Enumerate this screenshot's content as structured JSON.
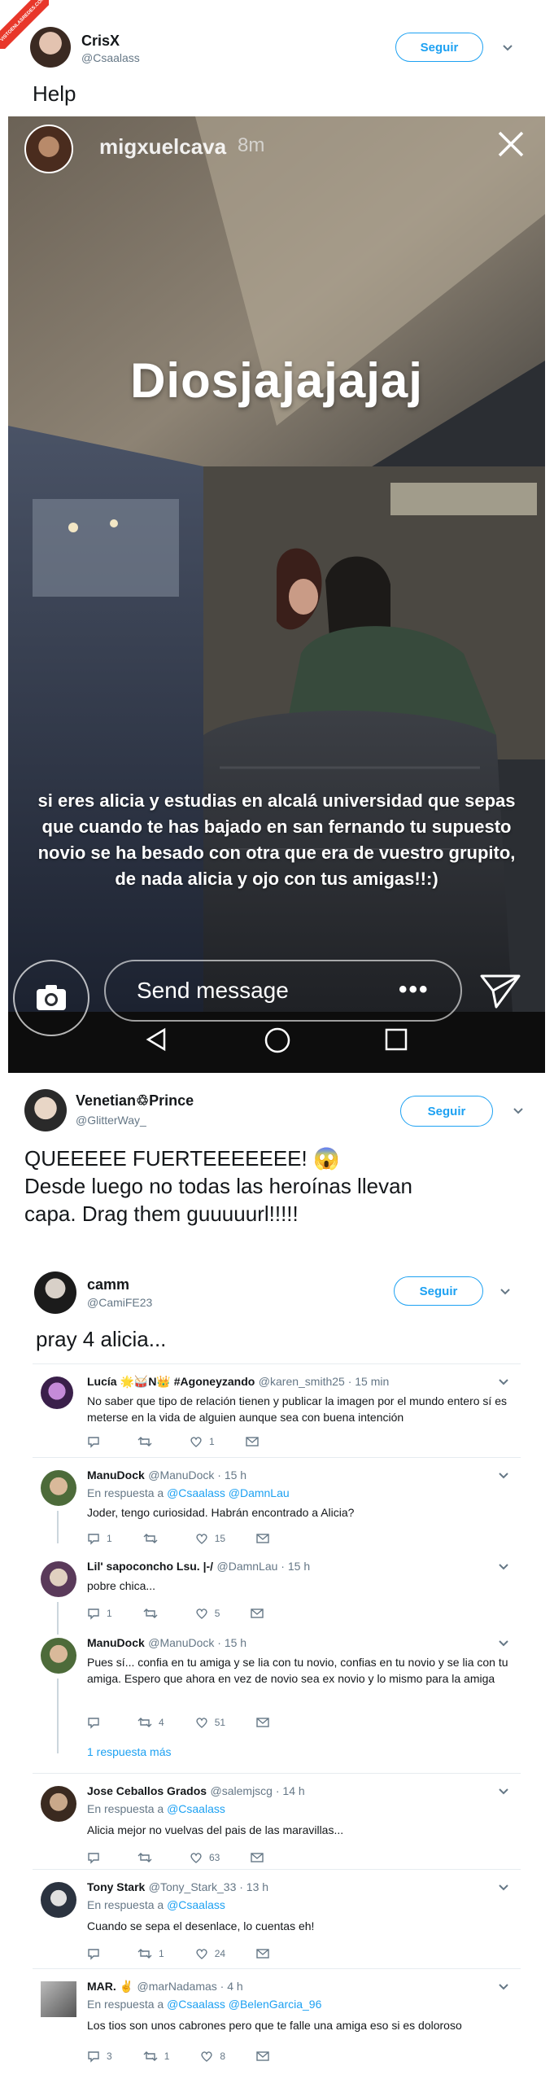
{
  "watermark": {
    "text": "VISTOENLASREDES.COM"
  },
  "main_tweet": {
    "name": "CrisX",
    "handle": "@Csaalass",
    "follow_label": "Seguir",
    "text": "Help"
  },
  "story": {
    "user": "migxuelcava",
    "time": "8m",
    "headline": "Diosjajajajaj",
    "caption_lines": [
      "si eres alicia y estudias en alcalá universidad que sepas",
      "que cuando te has bajado en san fernando tu  supuesto",
      "novio se ha besado con otra que era de vuestro grupito,",
      "de nada alicia y ojo con tus amigas!!:)"
    ],
    "send_placeholder": "Send message"
  },
  "quote_tweet": {
    "name": "Venetian♲Prince",
    "handle": "@GlitterWay_",
    "follow_label": "Seguir",
    "text_lines": [
      "QUEEEEE FUERTEEEEEEE! 😱",
      "Desde luego no todas las heroínas llevan",
      "capa. Drag them guuuuurl!!!!!"
    ]
  },
  "second_tweet": {
    "name": "camm",
    "handle": "@CamiFE23",
    "follow_label": "Seguir",
    "text": "pray 4 alicia..."
  },
  "replies": [
    {
      "name": "Lucía 🌟🥁N👑 #Agoneyzando",
      "handle": "@karen_smith25 · 15 min",
      "reply_to": "",
      "text": "No saber que tipo de relación tienen y publicar la imagen por el mundo entero sí es meterse en la vida de alguien aunque sea con buena intención",
      "comments": "",
      "retweets": "",
      "likes": "1"
    },
    {
      "name": "ManuDock",
      "handle": "@ManuDock · 15 h",
      "reply_prefix": "En respuesta a",
      "reply_to": "@Csaalass @DamnLau",
      "text": "Joder, tengo curiosidad. Habrán encontrado a Alicia?",
      "comments": "1",
      "retweets": "",
      "likes": "15"
    },
    {
      "name": "Lil' sapoconcho Lsu. |-/",
      "handle": "@DamnLau · 15 h",
      "reply_to": "",
      "text": "pobre chica...",
      "comments": "1",
      "retweets": "",
      "likes": "5"
    },
    {
      "name": "ManuDock",
      "handle": "@ManuDock · 15 h",
      "reply_to": "",
      "text": "Pues sí... confia en tu amiga y se lia con tu novio, confias en tu novio y se lia con tu amiga. Espero que ahora en vez de novio sea ex novio y lo mismo para la amiga",
      "comments": "",
      "retweets": "4",
      "likes": "51"
    },
    {
      "name": "Jose Ceballos Grados",
      "handle": "@salemjscg · 14 h",
      "reply_prefix": "En respuesta a",
      "reply_to": "@Csaalass",
      "text": "Alicia mejor no vuelvas del pais de las maravillas...",
      "comments": "",
      "retweets": "",
      "likes": "63"
    },
    {
      "name": "Tony Stark",
      "handle": "@Tony_Stark_33 · 13 h",
      "reply_prefix": "En respuesta a",
      "reply_to": "@Csaalass",
      "text": "Cuando se sepa el desenlace, lo cuentas eh!",
      "comments": "",
      "retweets": "1",
      "likes": "24"
    },
    {
      "name": "MAR. ✌",
      "handle": "@marNadamas · 4 h",
      "reply_prefix": "En respuesta a",
      "reply_to": "@Csaalass @BelenGarcia_96",
      "text": "Los tios son unos cabrones pero que te falle una amiga eso si es doloroso",
      "comments": "3",
      "retweets": "1",
      "likes": "8"
    }
  ],
  "more_replies": "1 respuesta más",
  "colors": {
    "accent": "#1da1f2",
    "secondary": "#657786",
    "divider": "#e6ecf0"
  }
}
